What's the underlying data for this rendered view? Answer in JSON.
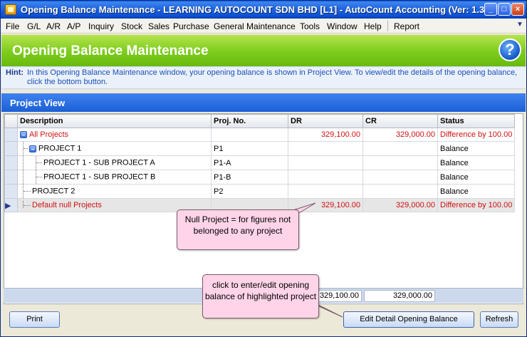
{
  "window": {
    "title": "Opening Balance Maintenance - LEARNING AUTOCOUNT SDN BHD [L1] - AutoCount Accounting (Ver: 1.3....",
    "minimize_icon": "minimize-icon",
    "maximize_icon": "maximize-icon",
    "close_icon": "close-icon"
  },
  "menu": {
    "items": [
      "File",
      "G/L",
      "A/R",
      "A/P",
      "Inquiry",
      "Stock",
      "Sales",
      "Purchase",
      "General Maintenance",
      "Tools",
      "Window",
      "Help",
      "Report"
    ]
  },
  "header": {
    "title": "Opening Balance Maintenance",
    "help_icon": "help-icon"
  },
  "hint": {
    "label": "Hint:",
    "text": "In this Opening Balance Maintenance window, your opening balance is shown in Project View. To view/edit the details of the opening balance, click the bottom button."
  },
  "project_view": {
    "title": "Project View"
  },
  "grid": {
    "columns": [
      "Description",
      "Proj. No.",
      "DR",
      "CR",
      "Status"
    ],
    "rows": [
      {
        "description": "All Projects",
        "proj_no": "",
        "dr": "329,100.00",
        "cr": "329,000.00",
        "status": "Difference by 100.00"
      },
      {
        "description": "PROJECT 1",
        "proj_no": "P1",
        "dr": "",
        "cr": "",
        "status": "Balance"
      },
      {
        "description": "PROJECT 1 - SUB PROJECT A",
        "proj_no": "P1-A",
        "dr": "",
        "cr": "",
        "status": "Balance"
      },
      {
        "description": "PROJECT 1 - SUB PROJECT B",
        "proj_no": "P1-B",
        "dr": "",
        "cr": "",
        "status": "Balance"
      },
      {
        "description": "PROJECT 2",
        "proj_no": "P2",
        "dr": "",
        "cr": "",
        "status": "Balance"
      },
      {
        "description": "Default null Projects",
        "proj_no": "",
        "dr": "329,100.00",
        "cr": "329,000.00",
        "status": "Difference by 100.00"
      }
    ],
    "totals": {
      "dr": "329,100.00",
      "cr": "329,000.00"
    }
  },
  "callouts": {
    "null_project": "Null Project = for figures not belonged to any project",
    "edit_hint": "click to enter/edit opening balance of highlighted project"
  },
  "buttons": {
    "print": "Print",
    "edit_detail": "Edit Detail Opening Balance",
    "refresh": "Refresh"
  },
  "colors": {
    "header_green": "#7ccc1c",
    "title_blue": "#1b5fd6",
    "difference_red": "#d01010",
    "callout_pink": "#ffd4e8"
  }
}
